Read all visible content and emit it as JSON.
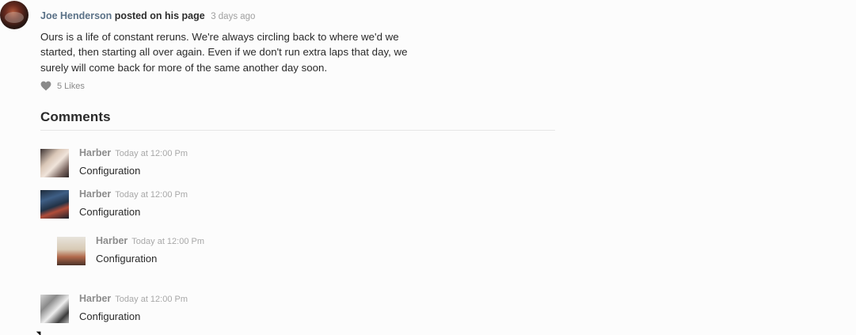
{
  "post": {
    "author": "Joe Henderson",
    "action": "posted on his page",
    "time": "3 days ago",
    "body": "Ours is a life of constant reruns. We're always circling back to where we'd we started, then starting all over again. Even if we don't run extra laps that day, we surely will come back for more of the same another day soon.",
    "likes": "5 Likes"
  },
  "comments": {
    "title": "Comments",
    "items": [
      {
        "name": "Harber",
        "time": "Today at 12:00 Pm",
        "text": "Configuration"
      },
      {
        "name": "Harber",
        "time": "Today at 12:00 Pm",
        "text": "Configuration"
      },
      {
        "name": "Harber",
        "time": "Today at 12:00 Pm",
        "text": "Configuration"
      },
      {
        "name": "Harber",
        "time": "Today at 12:00 Pm",
        "text": "Configuration"
      }
    ]
  },
  "icons": {
    "like": "heart-icon"
  },
  "colors": {
    "author_link": "#5a7187",
    "muted": "#a0a0a0",
    "heart": "#8a8a8a",
    "divider": "#e6e6e6"
  }
}
